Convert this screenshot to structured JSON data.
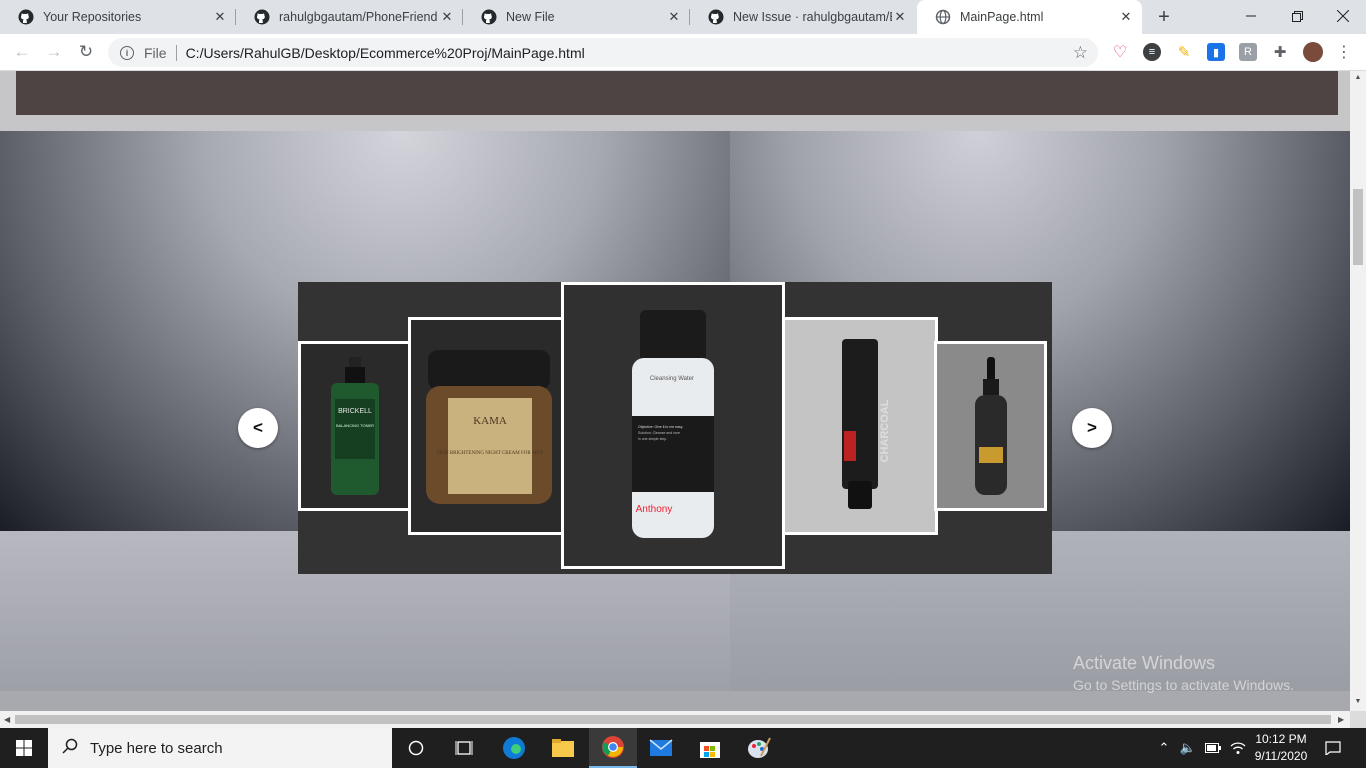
{
  "browser": {
    "tabs": [
      {
        "title": "Your Repositories",
        "icon": "github-icon"
      },
      {
        "title": "rahulgbgautam/PhoneFriend",
        "icon": "github-icon"
      },
      {
        "title": "New File",
        "icon": "github-icon"
      },
      {
        "title": "New Issue · rahulgbgautam/Ec",
        "icon": "github-icon"
      },
      {
        "title": "MainPage.html",
        "icon": "globe-icon",
        "active": true
      }
    ],
    "address": {
      "scheme": "File",
      "url": "C:/Users/RahulGB/Desktop/Ecommerce%20Proj/MainPage.html"
    }
  },
  "page": {
    "carousel": {
      "prev_label": "<",
      "next_label": ">",
      "products": [
        {
          "name": "Brickell Balancing Toner",
          "brand": "BRICKELL",
          "label": "BALANCING TONER"
        },
        {
          "name": "Kama Ayurveda Skin Brightening Night Cream For Men",
          "brand": "KAMA",
          "label": "SKIN BRIGHTENING NIGHT CREAM FOR MEN"
        },
        {
          "name": "Anthony Cleansing Water",
          "brand": "Anthony",
          "label": "Cleansing Water"
        },
        {
          "name": "Beardo Charcoal Face Wash",
          "brand": "",
          "label": "CHARCOAL"
        },
        {
          "name": "Beard Serum Dropper Bottle",
          "brand": "",
          "label": ""
        }
      ]
    },
    "watermark": {
      "line1": "Activate Windows",
      "line2": "Go to Settings to activate Windows."
    }
  },
  "taskbar": {
    "search_placeholder": "Type here to search",
    "time": "10:12 PM",
    "date": "9/11/2020"
  },
  "colors": {
    "tabstrip": "#dee1e6",
    "brown_bar": "#4d4443",
    "carousel_bg": "#333333",
    "taskbar": "#1f1f1f"
  }
}
